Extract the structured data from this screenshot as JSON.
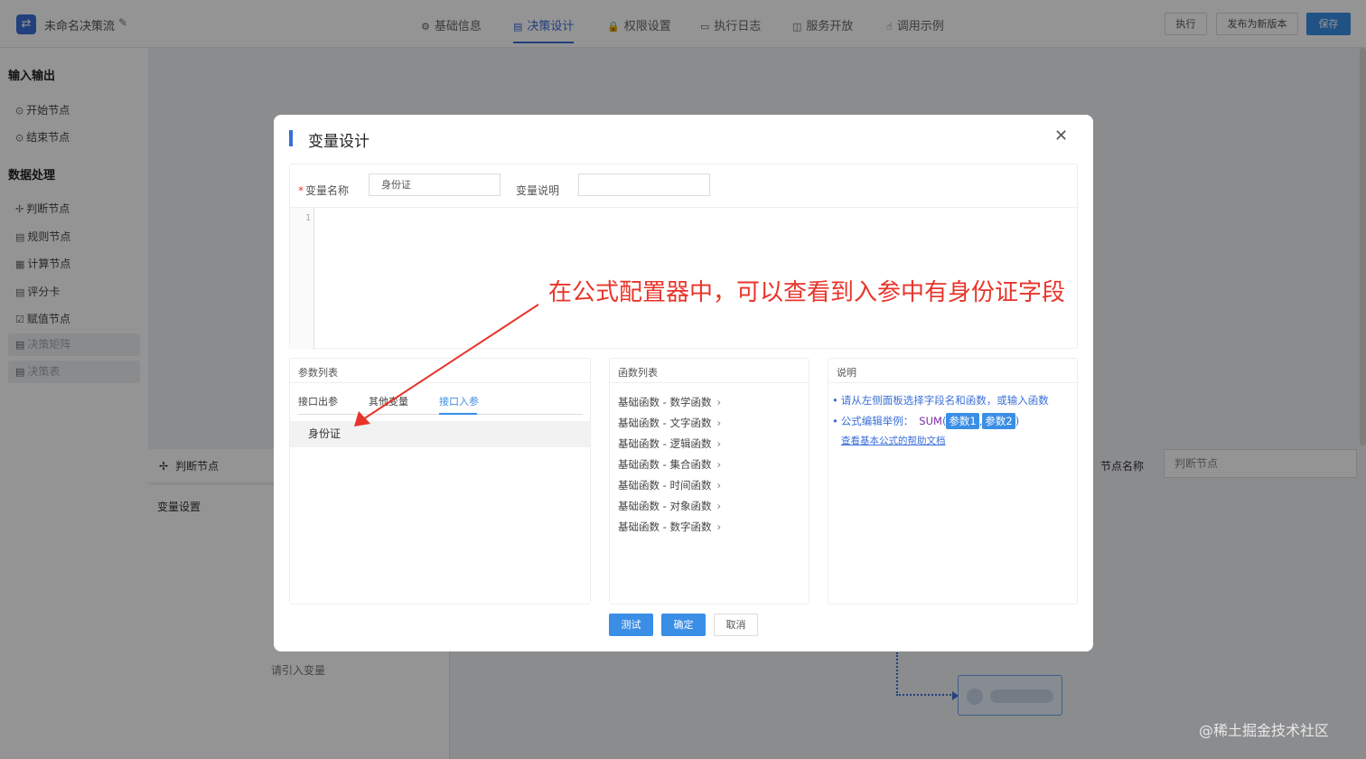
{
  "app": {
    "title": "未命名决策流",
    "logo_icon": "flow-logo-icon"
  },
  "nav": {
    "tabs": [
      {
        "label": "基础信息",
        "icon": "⚙"
      },
      {
        "label": "决策设计",
        "icon": "▤"
      },
      {
        "label": "权限设置",
        "icon": "🔒"
      },
      {
        "label": "执行日志",
        "icon": "▭"
      },
      {
        "label": "服务开放",
        "icon": "◫"
      },
      {
        "label": "调用示例",
        "icon": "☝"
      }
    ],
    "active_tab": "决策设计"
  },
  "toolbar": {
    "run": "执行",
    "publish": "发布为新版本",
    "save": "保存"
  },
  "sidebar": {
    "groups": [
      {
        "title": "输入输出",
        "items": [
          "开始节点",
          "结束节点"
        ]
      },
      {
        "title": "数据处理",
        "items": [
          "判断节点",
          "规则节点",
          "计算节点",
          "评分卡",
          "赋值节点",
          "决策矩阵",
          "决策表"
        ]
      }
    ]
  },
  "canvas": {
    "node_header": "判断节点",
    "var_settings": "变量设置",
    "var_hint": "请引入变量",
    "node_name_label": "节点名称",
    "node_name_value": "判断节点"
  },
  "modal": {
    "title": "变量设计",
    "var_name_label": "变量名称",
    "var_name_value": "身份证",
    "var_desc_label": "变量说明",
    "var_desc_value": "",
    "line_number": "1",
    "param_panel": {
      "title": "参数列表",
      "tabs": [
        "接口出参",
        "其他变量",
        "接口入参"
      ],
      "active_tab": "接口入参",
      "items": [
        "身份证"
      ]
    },
    "func_panel": {
      "title": "函数列表",
      "items": [
        "基础函数 - 数学函数",
        "基础函数 - 文字函数",
        "基础函数 - 逻辑函数",
        "基础函数 - 集合函数",
        "基础函数 - 时间函数",
        "基础函数 - 对象函数",
        "基础函数 - 数字函数"
      ]
    },
    "desc_panel": {
      "title": "说明",
      "tip1": "请从左侧面板选择字段名和函数，或输入函数",
      "tip2_prefix": "公式编辑举例：",
      "sum_keyword": "SUM",
      "paren_open": "(",
      "paren_close": ")",
      "comma": ",",
      "arg1": "参数1",
      "arg2": "参数2",
      "help_link": "查看基本公式的帮助文档"
    },
    "buttons": {
      "test": "测试",
      "confirm": "确定",
      "cancel": "取消"
    }
  },
  "annotation": {
    "text": "在公式配置器中，可以查看到入参中有身份证字段",
    "color": "#e8342a"
  },
  "watermark": "@稀土掘金技术社区"
}
